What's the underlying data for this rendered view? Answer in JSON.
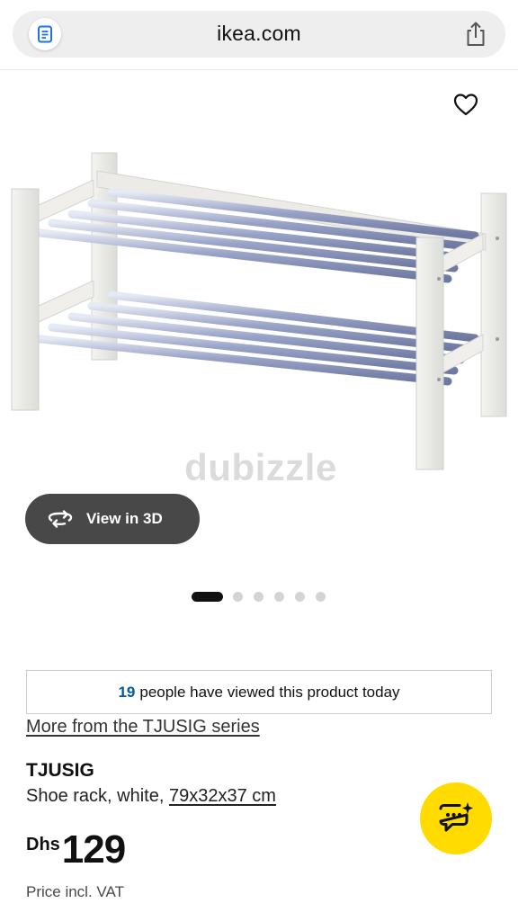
{
  "browser": {
    "url": "ikea.com",
    "reader_icon": "reader-icon",
    "share_icon": "share-icon"
  },
  "gallery": {
    "favorite_icon": "heart-icon",
    "watermark": "dubizzle",
    "view3d_label": "View in 3D",
    "view3d_icon": "rotate-3d-icon",
    "dots_total": 6,
    "dots_active_index": 0
  },
  "info": {
    "viewed_count": "19",
    "viewed_text": "people have viewed this product today",
    "series_link": "More from the TJUSIG series",
    "product_name": "TJUSIG",
    "product_desc": "Shoe rack, white, ",
    "product_dims": "79x32x37 cm",
    "currency": "Dhs",
    "price": "129",
    "price_note": "Price incl. VAT"
  },
  "chat": {
    "icon": "chat-sparkle-icon"
  },
  "colors": {
    "accent_yellow": "#ffdb00",
    "link_blue": "#0058a3",
    "button_dark": "#484848"
  }
}
